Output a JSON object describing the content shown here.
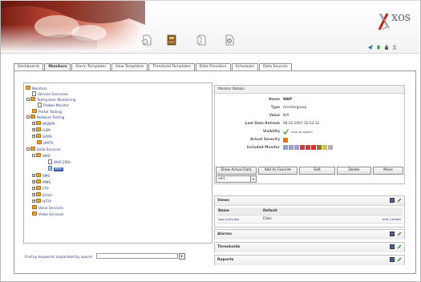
{
  "banner": {
    "logo": "xos",
    "toolbar_icons": [
      "document-icon",
      "book-icon",
      "pages-icon",
      "settings-doc-icon"
    ],
    "top_icons": [
      "arrow-icon",
      "leaf-icon",
      "lock-icon",
      "user-icon"
    ]
  },
  "tabs": [
    {
      "label": "Dashboards",
      "active": false
    },
    {
      "label": "Monitors",
      "active": true
    },
    {
      "label": "Alarm Templates",
      "active": false
    },
    {
      "label": "View Templates",
      "active": false
    },
    {
      "label": "Threshold Templates",
      "active": false
    },
    {
      "label": "Data Providers",
      "active": false
    },
    {
      "label": "Schedules",
      "active": false
    },
    {
      "label": "Data Sources",
      "active": false
    }
  ],
  "tree": [
    {
      "label": "Monitors",
      "icon": "folder-icon",
      "toggle": ""
    },
    {
      "label": "Service Overview",
      "icon": "page-icon",
      "toggle": ""
    },
    {
      "label": "Testsystem Monitoring",
      "icon": "folder-icon",
      "toggle": "-"
    },
    {
      "label": "Probes Monitor",
      "icon": "page-icon",
      "toggle": ""
    },
    {
      "label": "Portal Testing",
      "icon": "folder-icon",
      "toggle": ""
    },
    {
      "label": "Network Testing",
      "icon": "folder-icon",
      "toggle": "-"
    },
    {
      "label": "WSDPA",
      "icon": "folder-icon",
      "toggle": "+"
    },
    {
      "label": "GSM",
      "icon": "folder-icon",
      "toggle": "+"
    },
    {
      "label": "GRPS",
      "icon": "folder-icon",
      "toggle": "+"
    },
    {
      "label": "UMTS",
      "icon": "folder-icon",
      "toggle": ""
    },
    {
      "label": "Data Services",
      "icon": "folder-icon",
      "toggle": "-"
    },
    {
      "label": "WAP",
      "icon": "folder-icon",
      "toggle": "-"
    },
    {
      "label": "WAP 200s",
      "icon": "page-icon",
      "toggle": ""
    },
    {
      "label": "WAP",
      "icon": "page-blue-icon",
      "toggle": ""
    },
    {
      "label": "SMS",
      "icon": "folder-icon",
      "toggle": "+"
    },
    {
      "label": "MMS",
      "icon": "folder-icon",
      "toggle": "+"
    },
    {
      "label": "FTP",
      "icon": "folder-icon",
      "toggle": "+"
    },
    {
      "label": "Email",
      "icon": "folder-icon",
      "toggle": "+"
    },
    {
      "label": "HTTP",
      "icon": "folder-icon",
      "toggle": "+"
    },
    {
      "label": "Voice Services",
      "icon": "folder-icon",
      "toggle": ""
    },
    {
      "label": "Video Services",
      "icon": "folder-icon",
      "toggle": ""
    }
  ],
  "find": {
    "label": "Find by keywords (separated by space)",
    "value": "",
    "button_icon": "go-arrow-icon"
  },
  "details": {
    "heading": "Monitor Details",
    "fields": [
      {
        "label": "Name",
        "value": "WAP"
      },
      {
        "label": "Type",
        "value": "monitorgroup"
      },
      {
        "label": "Value",
        "value": "N/A"
      },
      {
        "label": "Last Data Refresh",
        "value": "08.02.2007 20:52:32"
      },
      {
        "label": "Visibility",
        "value": "click to switch"
      },
      {
        "label": "Actual Severity",
        "value": ""
      },
      {
        "label": "Included Monitor",
        "value": ""
      }
    ],
    "visibility_icon": "check-icon",
    "actual_severity_color": "#e07818",
    "included_monitor_colors": [
      "#9aa0c8",
      "#9aa0c8",
      "#9aa0c8",
      "#c04040",
      "#c04040",
      "#d03030",
      "#8a7a30",
      "#c8c848",
      "#b0b0b0"
    ],
    "buttons": [
      "Show Actual Data",
      "Add As Favorite",
      "Edit",
      "Delete",
      "Move"
    ],
    "select_value": "edit..."
  },
  "panels": {
    "views": {
      "title": "Views",
      "columns": [
        "Name",
        "Default"
      ],
      "rows": [
        {
          "name": "wap overview",
          "default": "False",
          "actions": "edit | delete"
        }
      ]
    },
    "alarms": {
      "title": "Alarms"
    },
    "thresholds": {
      "title": "Thresholds"
    },
    "reports": {
      "title": "Reports"
    }
  }
}
